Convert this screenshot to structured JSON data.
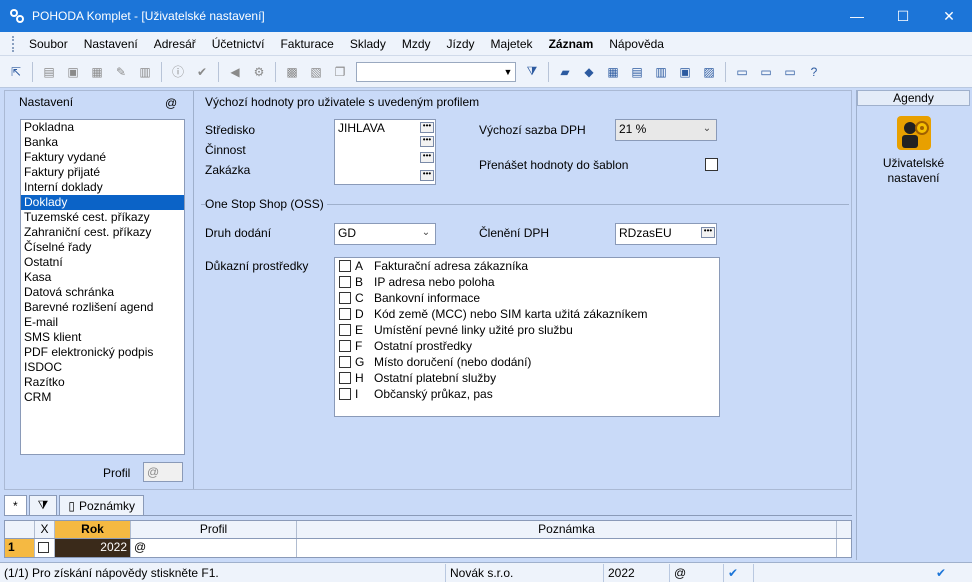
{
  "window": {
    "title": "POHODA Komplet - [Uživatelské nastavení]",
    "minimize": "—",
    "maximize": "☐",
    "close": "✕"
  },
  "menu": [
    "Soubor",
    "Nastavení",
    "Adresář",
    "Účetnictví",
    "Fakturace",
    "Sklady",
    "Mzdy",
    "Jízdy",
    "Majetek",
    "Záznam",
    "Nápověda"
  ],
  "settings_panel": {
    "label": "Nastavení",
    "at_symbol": "@",
    "items": [
      "Pokladna",
      "Banka",
      "Faktury vydané",
      "Faktury přijaté",
      "Interní doklady",
      "Doklady",
      "Tuzemské cest. příkazy",
      "Zahraniční cest. příkazy",
      "Číselné řady",
      "Ostatní",
      "Kasa",
      "Datová schránka",
      "Barevné rozlišení agend",
      "E-mail",
      "SMS klient",
      "PDF elektronický podpis",
      "ISDOC",
      "Razítko",
      "CRM"
    ],
    "selected": "Doklady",
    "profil_label": "Profil",
    "profil_value": "@"
  },
  "defaults": {
    "section_title": "Výchozí hodnoty pro uživatele s uvedeným profilem",
    "stredisko_label": "Středisko",
    "cinnost_label": "Činnost",
    "zakazka_label": "Zakázka",
    "stredisko_value": "JIHLAVA",
    "dph_label": "Výchozí sazba DPH",
    "dph_value": "21 %",
    "sablon_label": "Přenášet hodnoty do šablon",
    "dots": "•••"
  },
  "oss": {
    "section_title": "One Stop Shop (OSS)",
    "druh_label": "Druh dodání",
    "druh_value": "GD",
    "cleneni_label": "Členění DPH",
    "cleneni_value": "RDzasEU",
    "proof_label": "Důkazní prostředky",
    "proofs": [
      {
        "letter": "A",
        "text": "Fakturační adresa zákazníka"
      },
      {
        "letter": "B",
        "text": "IP adresa nebo poloha"
      },
      {
        "letter": "C",
        "text": "Bankovní informace"
      },
      {
        "letter": "D",
        "text": "Kód země (MCC) nebo SIM karta užitá zákazníkem"
      },
      {
        "letter": "E",
        "text": "Umístění pevné linky užité pro službu"
      },
      {
        "letter": "F",
        "text": "Ostatní prostředky"
      },
      {
        "letter": "G",
        "text": "Místo doručení (nebo dodání)"
      },
      {
        "letter": "H",
        "text": "Ostatní platební služby"
      },
      {
        "letter": "I",
        "text": "Občanský průkaz, pas"
      }
    ]
  },
  "agendy": {
    "header": "Agendy",
    "item_label_1": "Uživatelské",
    "item_label_2": "nastavení"
  },
  "bottom": {
    "tab_star": "*",
    "tab_notes": "Poznámky",
    "columns": {
      "x": "X",
      "rok": "Rok",
      "profil": "Profil",
      "poznamka": "Poznámka"
    },
    "rows": [
      {
        "num": "1",
        "rok": "2022",
        "profil": "@"
      }
    ]
  },
  "status": {
    "help": "(1/1) Pro získání nápovědy stiskněte F1.",
    "company": "Novák s.r.o.",
    "year": "2022",
    "at": "@"
  }
}
